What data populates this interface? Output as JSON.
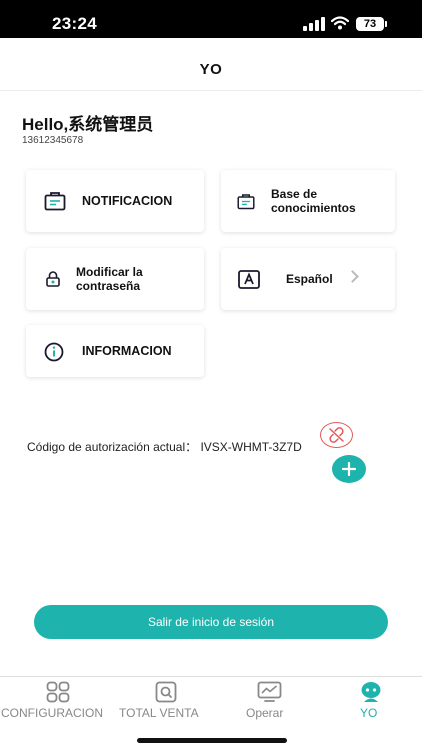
{
  "status_bar": {
    "time": "23:24",
    "battery": "73"
  },
  "header": {
    "title": "YO"
  },
  "user": {
    "greeting": "Hello,系统管理员",
    "phone": "13612345678"
  },
  "menu": {
    "notificacion": "NOTIFICACION",
    "base_line1": "Base de",
    "base_line2": "conocimientos",
    "password_line1": "Modificar la",
    "password_line2": "contraseña",
    "language": "Español",
    "informacion": "INFORMACION"
  },
  "auth": {
    "text": "Código de autorización actual： IVSX-WHMT-3Z7D"
  },
  "logout_label": "Salir de inicio de sesión",
  "tabs": [
    {
      "label": "CONFIGURACION",
      "icon": "grid-icon",
      "active": false
    },
    {
      "label": "TOTAL VENTA",
      "icon": "search-icon",
      "active": false
    },
    {
      "label": "Operar",
      "icon": "chart-monitor-icon",
      "active": false
    },
    {
      "label": "YO",
      "icon": "user-icon",
      "active": true
    }
  ],
  "colors": {
    "accent": "#1fb3ad",
    "danger": "#e05a5a"
  }
}
